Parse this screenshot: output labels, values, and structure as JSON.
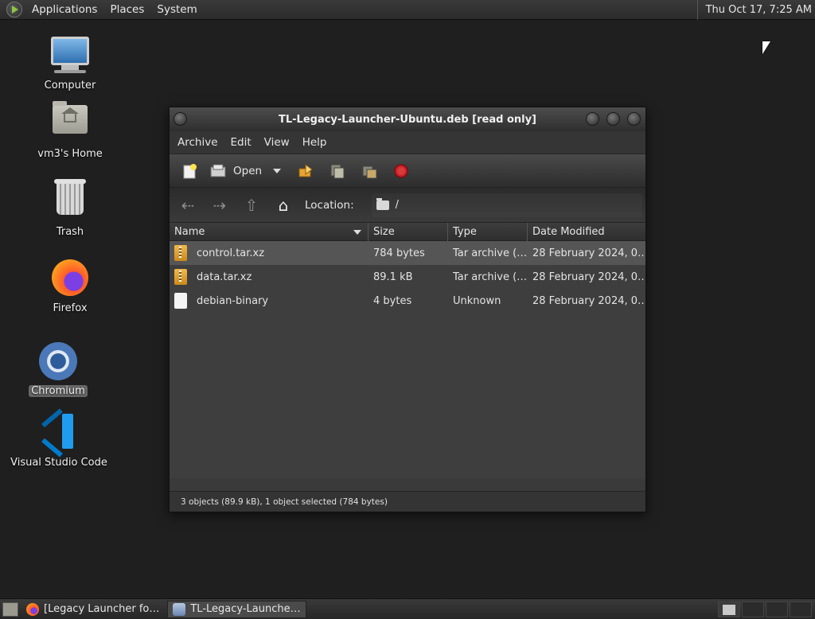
{
  "top_panel": {
    "menus": [
      "Applications",
      "Places",
      "System"
    ],
    "clock": "Thu Oct 17,  7:25 AM"
  },
  "desktop": {
    "icons": [
      {
        "label": "Computer",
        "icon": "computer-icon"
      },
      {
        "label": "vm3's Home",
        "icon": "home-folder-icon"
      },
      {
        "label": "Trash",
        "icon": "trash-icon"
      },
      {
        "label": "Firefox",
        "icon": "firefox-icon"
      },
      {
        "label": "Chromium",
        "icon": "chromium-icon",
        "selected": true
      },
      {
        "label": "Visual Studio Code",
        "icon": "vscode-icon"
      }
    ]
  },
  "window": {
    "title": "TL-Legacy-Launcher-Ubuntu.deb [read only]",
    "menu": [
      "Archive",
      "Edit",
      "View",
      "Help"
    ],
    "toolbar": {
      "open_label": "Open"
    },
    "location": {
      "label": "Location:",
      "path": "/"
    },
    "columns": [
      "Name",
      "Size",
      "Type",
      "Date Modified"
    ],
    "files": [
      {
        "name": "control.tar.xz",
        "size": "784 bytes",
        "type": "Tar archive (…",
        "date": "28 February 2024, 0…",
        "icon": "archive-icon",
        "selected": true
      },
      {
        "name": "data.tar.xz",
        "size": "89.1 kB",
        "type": "Tar archive (…",
        "date": "28 February 2024, 0…",
        "icon": "archive-icon",
        "selected": false
      },
      {
        "name": "debian-binary",
        "size": "4 bytes",
        "type": "Unknown",
        "date": "28 February 2024, 0…",
        "icon": "file-icon",
        "selected": false
      }
    ],
    "status": "3 objects (89.9 kB), 1 object selected (784 bytes)"
  },
  "taskbar": {
    "tasks": [
      {
        "label": "[Legacy Launcher fo…",
        "icon": "firefox-icon",
        "active": false
      },
      {
        "label": "TL-Legacy-Launche…",
        "icon": "archive-manager-icon",
        "active": true
      }
    ]
  }
}
